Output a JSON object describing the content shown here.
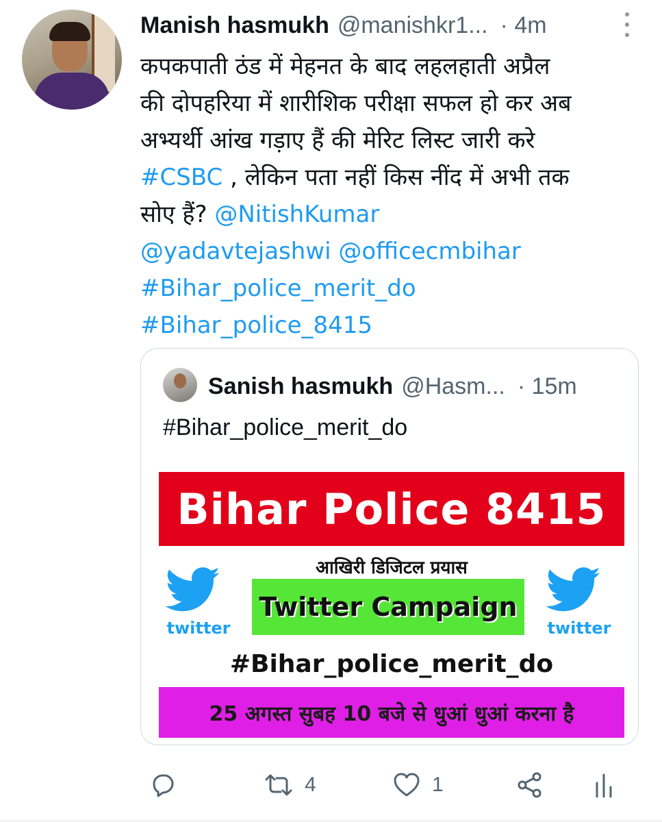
{
  "tweet": {
    "author_name": "Manish hasmukh",
    "author_handle": "@manishkr1...",
    "time": "· 4m",
    "lines": [
      "कपकपाती ठंड में मेहनत के बाद लहलहाती अप्रैल",
      "की दोपहरिया में शारीशिक परीक्षा सफल हो कर अब",
      "अभ्यर्थी आंख गड़ाए हैं की मेरिट लिस्ट जारी करे"
    ],
    "line4_hashtag": "#CSBC",
    "line4_rest": " , लेकिन पता नहीं किस नींद में अभी तक",
    "line5_text": "सोए हैं? ",
    "mention_nitish": "@NitishKumar",
    "mention_tejashwi": "@yadavtejashwi",
    "mention_cmo": "@officecmbihar",
    "hashtag_merit": "#Bihar_police_merit_do",
    "hashtag_8415": "#Bihar_police_8415"
  },
  "quoted": {
    "author_name": "Sanish hasmukh",
    "author_handle": "@Hasm...",
    "time": "· 15m",
    "text": "#Bihar_police_merit_do",
    "image": {
      "banner_title": "Bihar Police 8415",
      "subtitle": "आखिरी डिजिटल प्रयास",
      "campaign_label": "Twitter Campaign",
      "bird_word_left": "twitter",
      "bird_word_right": "twitter",
      "hashtag": "#Bihar_police_merit_do",
      "schedule": "25 अगस्त सुबह 10 बजे से धुआं धुआं करना है"
    }
  },
  "actions": {
    "reply_icon": "reply-icon",
    "retweet_count": "4",
    "like_count": "1",
    "share_icon": "share-icon",
    "analytics_icon": "analytics-icon"
  },
  "colors": {
    "link": "#1d9bf0",
    "muted": "#536471",
    "banner_red": "#e2001a",
    "banner_green": "#55e637",
    "banner_magenta": "#e01fe6"
  }
}
